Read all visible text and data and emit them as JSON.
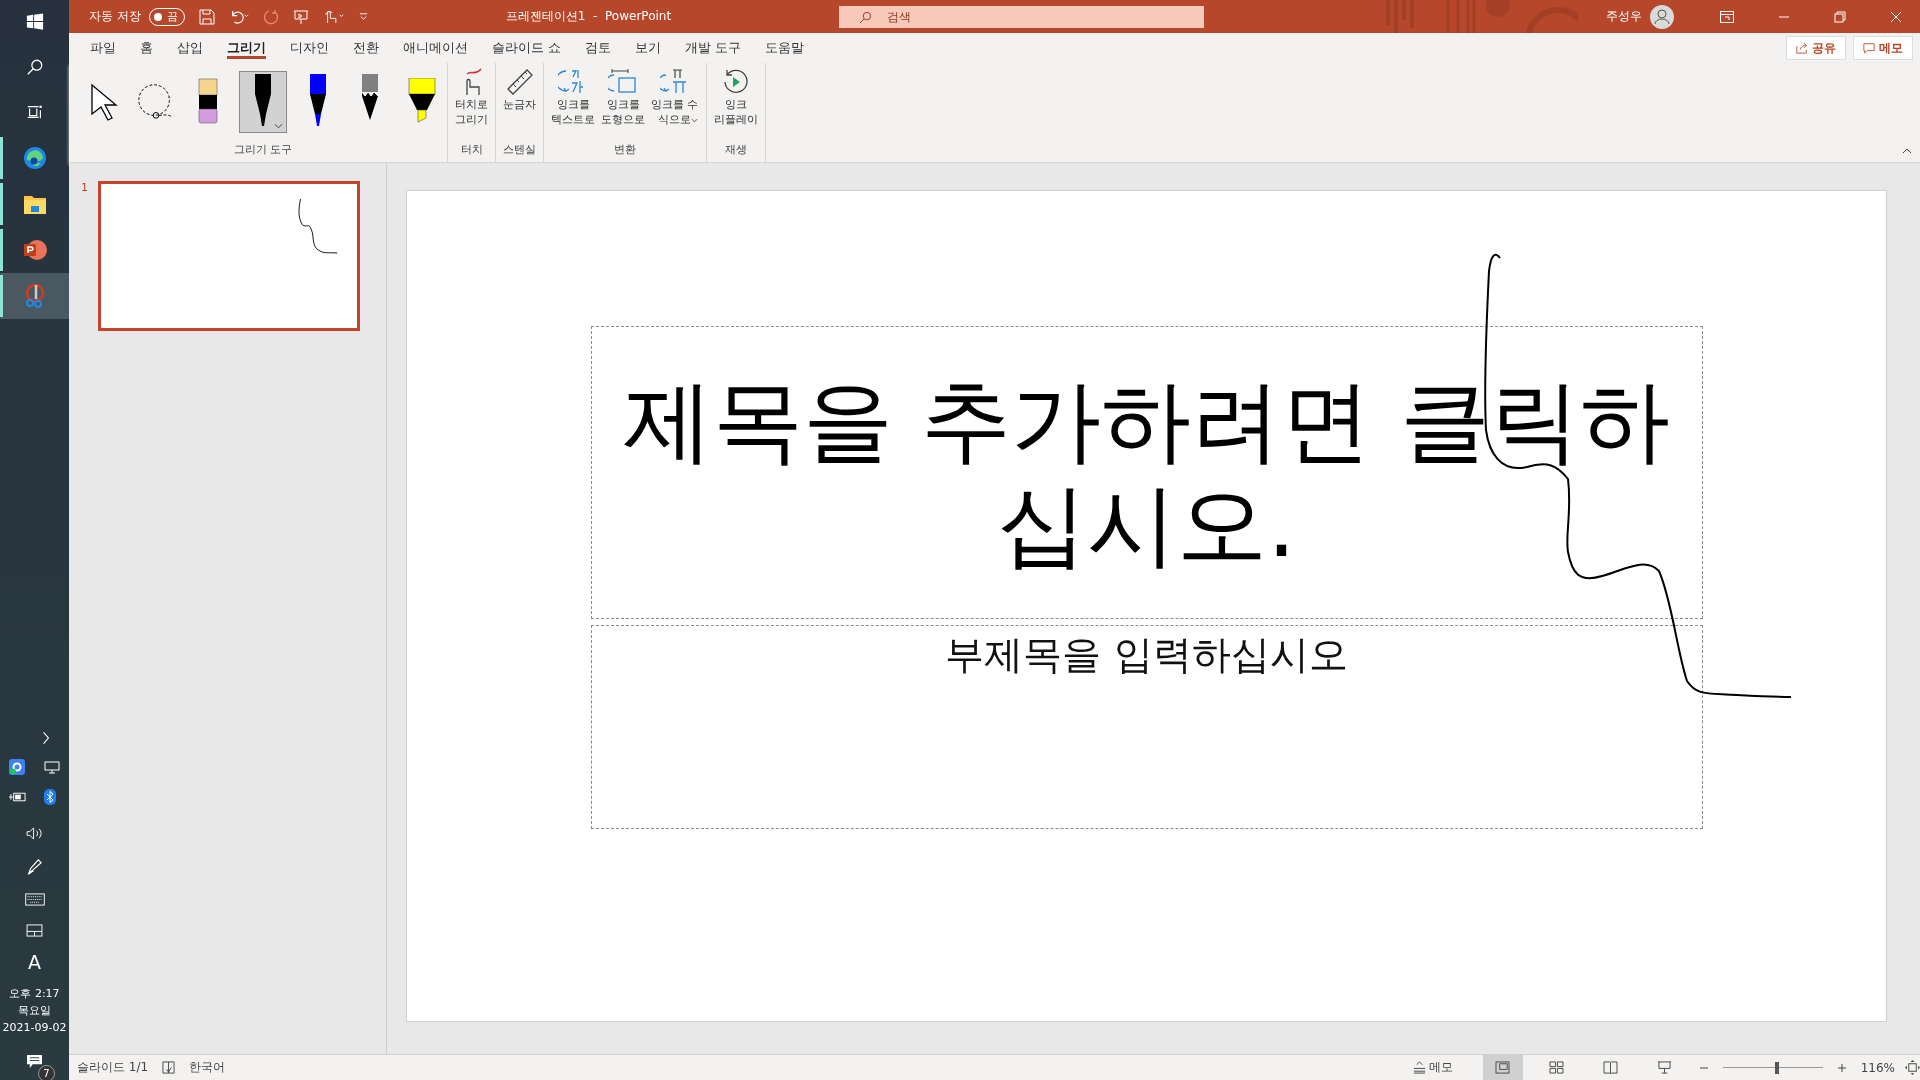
{
  "taskbar": {
    "apps": [
      {
        "kind": "browser",
        "running": true,
        "active": false
      },
      {
        "kind": "folder",
        "running": true,
        "active": false
      },
      {
        "kind": "presentation",
        "running": true,
        "active": false
      },
      {
        "kind": "snipping",
        "running": true,
        "active": true
      }
    ],
    "tray": {
      "keyboard_letter": "A",
      "clock": [
        "오후 2:17",
        "목요일",
        "2021-09-02"
      ],
      "notifications": "7"
    }
  },
  "title_bar": {
    "autosave_label": "자동 저장",
    "autosave": {
      "on": false,
      "text": "끔"
    },
    "document_title": "프레젠테이션1  -  PowerPoint",
    "search": {
      "placeholder": "검색"
    },
    "user": "주성우"
  },
  "tabs": [
    {
      "label": "파일",
      "selected": false
    },
    {
      "label": "홈",
      "selected": false
    },
    {
      "label": "삽입",
      "selected": false
    },
    {
      "label": "그리기",
      "selected": true
    },
    {
      "label": "디자인",
      "selected": false
    },
    {
      "label": "전환",
      "selected": false
    },
    {
      "label": "애니메이션",
      "selected": false
    },
    {
      "label": "슬라이드 쇼",
      "selected": false
    },
    {
      "label": "검토",
      "selected": false
    },
    {
      "label": "보기",
      "selected": false
    },
    {
      "label": "개발 도구",
      "selected": false
    },
    {
      "label": "도움말",
      "selected": false
    }
  ],
  "share_button": "공유",
  "comments_button": "메모",
  "ribbon": {
    "tools": {
      "label": "그리기 도구",
      "items": [
        {
          "kind": "select",
          "selected": false
        },
        {
          "kind": "lasso",
          "selected": false
        },
        {
          "kind": "eraser",
          "selected": false
        },
        {
          "kind": "pen",
          "color": "#000000",
          "selected": true
        },
        {
          "kind": "pen",
          "color": "#0000ff",
          "selected": false
        },
        {
          "kind": "pencil",
          "color": "#808080",
          "selected": false
        },
        {
          "kind": "highlighter",
          "color": "#ffff00",
          "selected": false
        }
      ]
    },
    "groups": [
      {
        "label": "터치",
        "buttons": [
          {
            "kind": "touch",
            "lines": [
              "터치로",
              "그리기"
            ]
          }
        ]
      },
      {
        "label": "스텐실",
        "buttons": [
          {
            "kind": "ruler",
            "lines": [
              "눈금자"
            ]
          }
        ]
      },
      {
        "label": "변환",
        "buttons": [
          {
            "kind": "ink-text",
            "lines": [
              "잉크를",
              "텍스트로"
            ]
          },
          {
            "kind": "ink-shape",
            "lines": [
              "잉크를",
              "도형으로"
            ]
          },
          {
            "kind": "ink-math",
            "lines": [
              "잉크를 수",
              "식으로"
            ],
            "dropdown": true
          }
        ]
      },
      {
        "label": "재생",
        "buttons": [
          {
            "kind": "replay",
            "lines": [
              "잉크",
              "리플레이"
            ]
          }
        ]
      }
    ]
  },
  "thumbnails": [
    {
      "number": "1",
      "selected": true
    }
  ],
  "slide": {
    "title": "제목을 추가하려면 클릭하십시오.",
    "subtitle": "부제목을 입력하십시오"
  },
  "status_bar": {
    "slide": "슬라이드 1/1",
    "language": "한국어",
    "notes": "메모",
    "views": [
      {
        "kind": "normal",
        "selected": true
      },
      {
        "kind": "sorter",
        "selected": false
      },
      {
        "kind": "reading",
        "selected": false
      },
      {
        "kind": "show",
        "selected": false
      }
    ],
    "zoom": {
      "level": 0.54,
      "text": "116%"
    }
  }
}
